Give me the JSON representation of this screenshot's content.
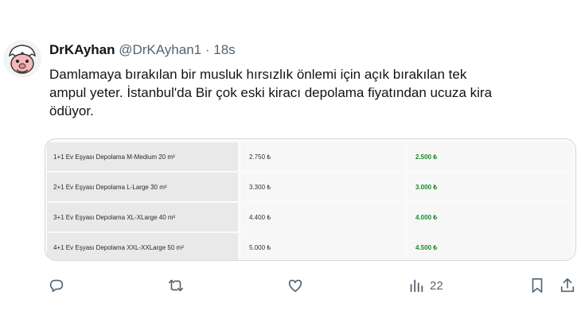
{
  "tweet": {
    "author_name": "DrKAyhan",
    "handle": "@DrKAyhan1",
    "separator": "·",
    "time": "18s",
    "text_lines": [
      "Damlamaya bırakılan bir musluk hırsızlık önlemi için açık bırakılan tek",
      "ampul yeter. İstanbul'da Bir çok eski kiracı depolama fiyatından ucuza kira",
      "ödüyor."
    ]
  },
  "table": {
    "rows": [
      {
        "name": "1+1 Ev Eşyası Depolama M-Medium 20 m²",
        "old_price": "2.750 ₺",
        "new_price": "2.500 ₺"
      },
      {
        "name": "2+1 Ev Eşyası Depolama L-Large 30 m²",
        "old_price": "3.300 ₺",
        "new_price": "3.000 ₺"
      },
      {
        "name": "3+1 Ev Eşyası Depolama XL-XLarge 40 m²",
        "old_price": "4.400 ₺",
        "new_price": "4.000 ₺"
      },
      {
        "name": "4+1 Ev Eşyası Depolama XXL-XXLarge 50 m²",
        "old_price": "5.000 ₺",
        "new_price": "4.500 ₺"
      }
    ]
  },
  "actions": {
    "reply_icon": "reply-icon",
    "retweet_icon": "retweet-icon",
    "like_icon": "heart-icon",
    "views_icon": "views-icon",
    "views_count": "22",
    "bookmark_icon": "bookmark-icon",
    "share_icon": "share-icon"
  },
  "colors": {
    "text": "#0f1419",
    "secondary": "#536471",
    "new_price": "#1a8a2a"
  }
}
